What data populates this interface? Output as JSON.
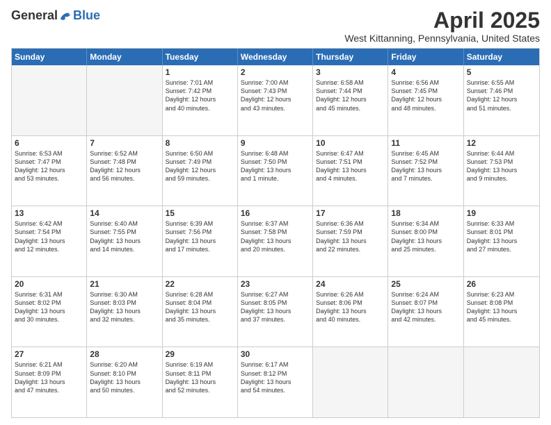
{
  "logo": {
    "general": "General",
    "blue": "Blue"
  },
  "title": "April 2025",
  "location": "West Kittanning, Pennsylvania, United States",
  "days_of_week": [
    "Sunday",
    "Monday",
    "Tuesday",
    "Wednesday",
    "Thursday",
    "Friday",
    "Saturday"
  ],
  "weeks": [
    [
      {
        "day": "",
        "empty": true,
        "lines": []
      },
      {
        "day": "",
        "empty": true,
        "lines": []
      },
      {
        "day": "1",
        "empty": false,
        "lines": [
          "Sunrise: 7:01 AM",
          "Sunset: 7:42 PM",
          "Daylight: 12 hours",
          "and 40 minutes."
        ]
      },
      {
        "day": "2",
        "empty": false,
        "lines": [
          "Sunrise: 7:00 AM",
          "Sunset: 7:43 PM",
          "Daylight: 12 hours",
          "and 43 minutes."
        ]
      },
      {
        "day": "3",
        "empty": false,
        "lines": [
          "Sunrise: 6:58 AM",
          "Sunset: 7:44 PM",
          "Daylight: 12 hours",
          "and 45 minutes."
        ]
      },
      {
        "day": "4",
        "empty": false,
        "lines": [
          "Sunrise: 6:56 AM",
          "Sunset: 7:45 PM",
          "Daylight: 12 hours",
          "and 48 minutes."
        ]
      },
      {
        "day": "5",
        "empty": false,
        "lines": [
          "Sunrise: 6:55 AM",
          "Sunset: 7:46 PM",
          "Daylight: 12 hours",
          "and 51 minutes."
        ]
      }
    ],
    [
      {
        "day": "6",
        "empty": false,
        "lines": [
          "Sunrise: 6:53 AM",
          "Sunset: 7:47 PM",
          "Daylight: 12 hours",
          "and 53 minutes."
        ]
      },
      {
        "day": "7",
        "empty": false,
        "lines": [
          "Sunrise: 6:52 AM",
          "Sunset: 7:48 PM",
          "Daylight: 12 hours",
          "and 56 minutes."
        ]
      },
      {
        "day": "8",
        "empty": false,
        "lines": [
          "Sunrise: 6:50 AM",
          "Sunset: 7:49 PM",
          "Daylight: 12 hours",
          "and 59 minutes."
        ]
      },
      {
        "day": "9",
        "empty": false,
        "lines": [
          "Sunrise: 6:48 AM",
          "Sunset: 7:50 PM",
          "Daylight: 13 hours",
          "and 1 minute."
        ]
      },
      {
        "day": "10",
        "empty": false,
        "lines": [
          "Sunrise: 6:47 AM",
          "Sunset: 7:51 PM",
          "Daylight: 13 hours",
          "and 4 minutes."
        ]
      },
      {
        "day": "11",
        "empty": false,
        "lines": [
          "Sunrise: 6:45 AM",
          "Sunset: 7:52 PM",
          "Daylight: 13 hours",
          "and 7 minutes."
        ]
      },
      {
        "day": "12",
        "empty": false,
        "lines": [
          "Sunrise: 6:44 AM",
          "Sunset: 7:53 PM",
          "Daylight: 13 hours",
          "and 9 minutes."
        ]
      }
    ],
    [
      {
        "day": "13",
        "empty": false,
        "lines": [
          "Sunrise: 6:42 AM",
          "Sunset: 7:54 PM",
          "Daylight: 13 hours",
          "and 12 minutes."
        ]
      },
      {
        "day": "14",
        "empty": false,
        "lines": [
          "Sunrise: 6:40 AM",
          "Sunset: 7:55 PM",
          "Daylight: 13 hours",
          "and 14 minutes."
        ]
      },
      {
        "day": "15",
        "empty": false,
        "lines": [
          "Sunrise: 6:39 AM",
          "Sunset: 7:56 PM",
          "Daylight: 13 hours",
          "and 17 minutes."
        ]
      },
      {
        "day": "16",
        "empty": false,
        "lines": [
          "Sunrise: 6:37 AM",
          "Sunset: 7:58 PM",
          "Daylight: 13 hours",
          "and 20 minutes."
        ]
      },
      {
        "day": "17",
        "empty": false,
        "lines": [
          "Sunrise: 6:36 AM",
          "Sunset: 7:59 PM",
          "Daylight: 13 hours",
          "and 22 minutes."
        ]
      },
      {
        "day": "18",
        "empty": false,
        "lines": [
          "Sunrise: 6:34 AM",
          "Sunset: 8:00 PM",
          "Daylight: 13 hours",
          "and 25 minutes."
        ]
      },
      {
        "day": "19",
        "empty": false,
        "lines": [
          "Sunrise: 6:33 AM",
          "Sunset: 8:01 PM",
          "Daylight: 13 hours",
          "and 27 minutes."
        ]
      }
    ],
    [
      {
        "day": "20",
        "empty": false,
        "lines": [
          "Sunrise: 6:31 AM",
          "Sunset: 8:02 PM",
          "Daylight: 13 hours",
          "and 30 minutes."
        ]
      },
      {
        "day": "21",
        "empty": false,
        "lines": [
          "Sunrise: 6:30 AM",
          "Sunset: 8:03 PM",
          "Daylight: 13 hours",
          "and 32 minutes."
        ]
      },
      {
        "day": "22",
        "empty": false,
        "lines": [
          "Sunrise: 6:28 AM",
          "Sunset: 8:04 PM",
          "Daylight: 13 hours",
          "and 35 minutes."
        ]
      },
      {
        "day": "23",
        "empty": false,
        "lines": [
          "Sunrise: 6:27 AM",
          "Sunset: 8:05 PM",
          "Daylight: 13 hours",
          "and 37 minutes."
        ]
      },
      {
        "day": "24",
        "empty": false,
        "lines": [
          "Sunrise: 6:26 AM",
          "Sunset: 8:06 PM",
          "Daylight: 13 hours",
          "and 40 minutes."
        ]
      },
      {
        "day": "25",
        "empty": false,
        "lines": [
          "Sunrise: 6:24 AM",
          "Sunset: 8:07 PM",
          "Daylight: 13 hours",
          "and 42 minutes."
        ]
      },
      {
        "day": "26",
        "empty": false,
        "lines": [
          "Sunrise: 6:23 AM",
          "Sunset: 8:08 PM",
          "Daylight: 13 hours",
          "and 45 minutes."
        ]
      }
    ],
    [
      {
        "day": "27",
        "empty": false,
        "lines": [
          "Sunrise: 6:21 AM",
          "Sunset: 8:09 PM",
          "Daylight: 13 hours",
          "and 47 minutes."
        ]
      },
      {
        "day": "28",
        "empty": false,
        "lines": [
          "Sunrise: 6:20 AM",
          "Sunset: 8:10 PM",
          "Daylight: 13 hours",
          "and 50 minutes."
        ]
      },
      {
        "day": "29",
        "empty": false,
        "lines": [
          "Sunrise: 6:19 AM",
          "Sunset: 8:11 PM",
          "Daylight: 13 hours",
          "and 52 minutes."
        ]
      },
      {
        "day": "30",
        "empty": false,
        "lines": [
          "Sunrise: 6:17 AM",
          "Sunset: 8:12 PM",
          "Daylight: 13 hours",
          "and 54 minutes."
        ]
      },
      {
        "day": "",
        "empty": true,
        "lines": []
      },
      {
        "day": "",
        "empty": true,
        "lines": []
      },
      {
        "day": "",
        "empty": true,
        "lines": []
      }
    ]
  ]
}
